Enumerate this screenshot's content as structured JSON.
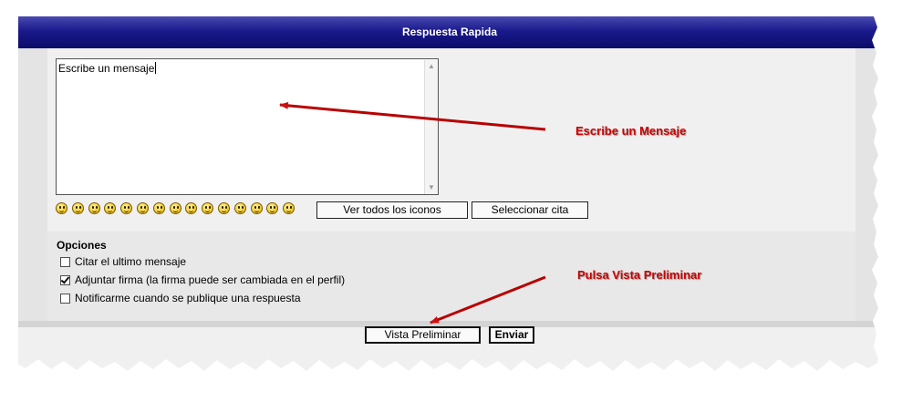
{
  "header": {
    "title": "Respuesta Rapida"
  },
  "message": {
    "text": "Escribe un mensaje"
  },
  "emoticons": [
    "emoticon-very-happy",
    "emoticon-grin",
    "emoticon-smile",
    "emoticon-laugh",
    "emoticon-sad",
    "emoticon-surprised",
    "emoticon-shocked",
    "emoticon-confused",
    "emoticon-cool",
    "emoticon-razz",
    "emoticon-embarrassed",
    "emoticon-wink",
    "emoticon-neutral",
    "emoticon-crying",
    "emoticon-evil"
  ],
  "buttons": {
    "all_icons": "Ver todos los iconos",
    "select_quote": "Seleccionar cita",
    "preview": "Vista Preliminar",
    "send": "Enviar"
  },
  "options": {
    "title": "Opciones",
    "items": [
      {
        "label": "Citar el ultimo mensaje",
        "checked": false
      },
      {
        "label": "Adjuntar firma (la firma puede ser cambiada en el perfil)",
        "checked": true
      },
      {
        "label": "Notificarme cuando se publique una respuesta",
        "checked": false
      }
    ]
  },
  "annotations": {
    "message": "Escribe un Mensaje",
    "preview": "Pulsa Vista Preliminar"
  },
  "colors": {
    "header": "#1a1a8c",
    "annotation": "#cc0000"
  }
}
